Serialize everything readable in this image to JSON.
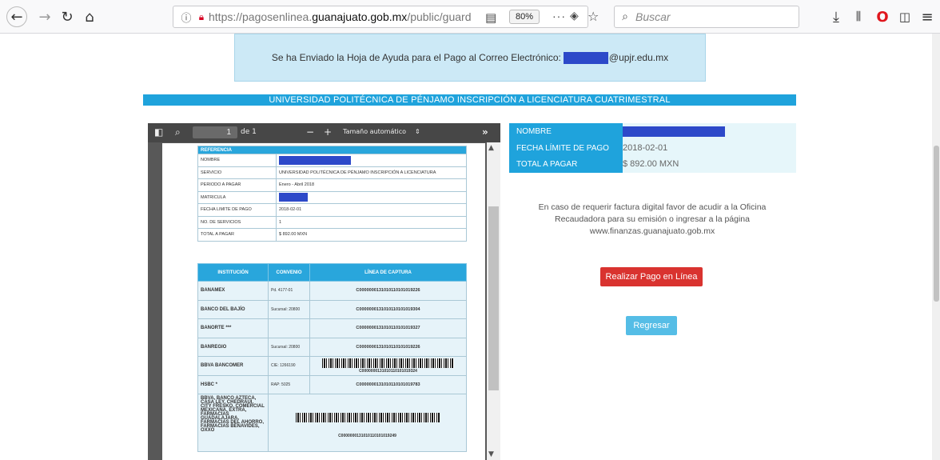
{
  "browser": {
    "url_prefix": "https://pagosenlinea.",
    "url_domain": "guanajuato.gob.mx",
    "url_path": "/public/guard",
    "zoom": "80%",
    "search_placeholder": "Buscar"
  },
  "banner": {
    "text_before": "Se ha Enviado la Hoja de Ayuda para el Pago al Correo Electrónico:",
    "text_after": "@upjr.edu.mx"
  },
  "title": "UNIVERSIDAD POLITÉCNICA DE PÉNJAMO INSCRIPCIÓN A LICENCIATURA CUATRIMESTRAL",
  "pdf": {
    "page_number": "1",
    "page_of": "de 1",
    "zoom_label": "Tamaño automático",
    "reference": {
      "header": "REFERENCIA",
      "rows": [
        {
          "label": "NOMBRE",
          "value": ""
        },
        {
          "label": "SERVICIO",
          "value": "UNIVERSIDAD POLITÉCNICA DE PÉNJAMO INSCRIPCIÓN A LICENCIATURA"
        },
        {
          "label": "PERIODO A PAGAR",
          "value": "Enero - Abril 2018"
        },
        {
          "label": "MATRICULA",
          "value": ""
        },
        {
          "label": "FECHA LIMITE DE PAGO",
          "value": "2018-02-01"
        },
        {
          "label": "NO. DE SERVICIOS",
          "value": "1"
        },
        {
          "label": "TOTAL A PAGAR",
          "value": "$ 892.00 MXN"
        }
      ]
    },
    "banks": {
      "headers": [
        "INSTITUCIÓN",
        "CONVENIO",
        "LÍNEA DE CAPTURA"
      ],
      "rows": [
        {
          "bank": "BANAMEX",
          "convenio": "Pd. 4177-01",
          "line": "C0000000131010110101019226"
        },
        {
          "bank": "BANCO DEL BAJÍO",
          "convenio": "Sucursal: 20800",
          "line": "C0000000131010110101019304"
        },
        {
          "bank": "BANORTE ***",
          "convenio": "",
          "line": "C0000000131010110101019327"
        },
        {
          "bank": "BANREGIO",
          "convenio": "Sucursal: 20800",
          "line": "C0000000131010110101019226"
        },
        {
          "bank": "BBVA BANCOMER",
          "convenio": "CIE: 1266190",
          "line": "C0000000131010110101019324"
        },
        {
          "bank": "HSBC *",
          "convenio": "RAP: 5025",
          "line": "C0000000131010110101019783"
        },
        {
          "bank": "BBVA, BANCO AZTECA, CASA LEY, CHEDRAUI, CITY FRESKO, COMERCIAL MEXICANA, EXTRA, FARMACIAS GUADALAJARA, FARMACIAS DEL AHORRO, FARMACIAS BENAVIDES, OXXO",
          "convenio": "",
          "line": "C0000000131010110101019249"
        }
      ]
    }
  },
  "info": {
    "rows": [
      {
        "label": "NOMBRE",
        "value": ""
      },
      {
        "label": "FECHA LÍMITE DE PAGO",
        "value": "2018-02-01"
      },
      {
        "label": "TOTAL A PAGAR",
        "value": "$ 892.00 MXN"
      }
    ]
  },
  "note": "En caso de requerir factura digital favor de acudir a la Oficina Recaudadora para su emisión o ingresar a la página www.finanzas.guanajuato.gob.mx",
  "buttons": {
    "pay": "Realizar Pago en Línea",
    "back": "Regresar"
  },
  "colors": {
    "accent_blue": "#1fa3dc",
    "pay_red": "#d9332f",
    "redaction": "#2d49c9"
  }
}
